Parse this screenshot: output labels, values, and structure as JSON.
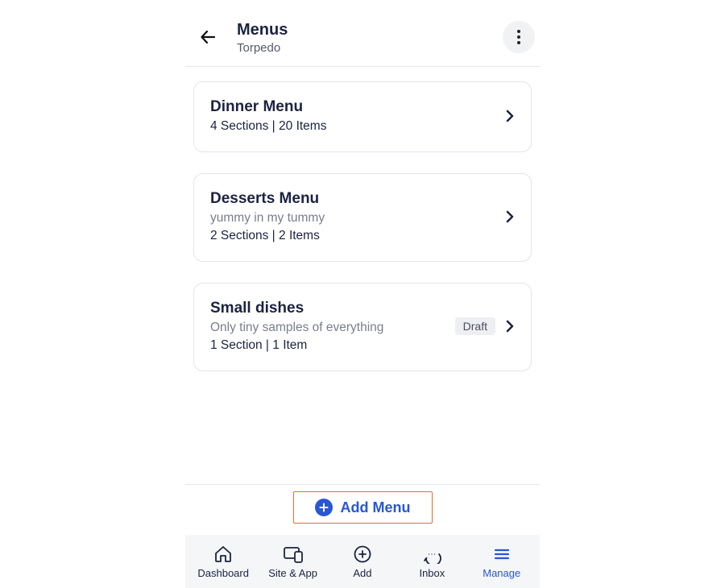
{
  "header": {
    "title": "Menus",
    "subtitle": "Torpedo"
  },
  "menus": [
    {
      "title": "Dinner Menu",
      "description": "",
      "meta": "4 Sections | 20 Items",
      "badge": ""
    },
    {
      "title": "Desserts Menu",
      "description": "yummy in my tummy",
      "meta": "2 Sections | 2 Items",
      "badge": ""
    },
    {
      "title": "Small dishes",
      "description": "Only tiny samples of everything",
      "meta": "1 Section | 1 Item",
      "badge": "Draft"
    }
  ],
  "addButton": {
    "label": "Add Menu"
  },
  "nav": {
    "items": [
      {
        "label": "Dashboard"
      },
      {
        "label": "Site & App"
      },
      {
        "label": "Add"
      },
      {
        "label": "Inbox"
      },
      {
        "label": "Manage"
      }
    ],
    "activeIndex": 4
  }
}
